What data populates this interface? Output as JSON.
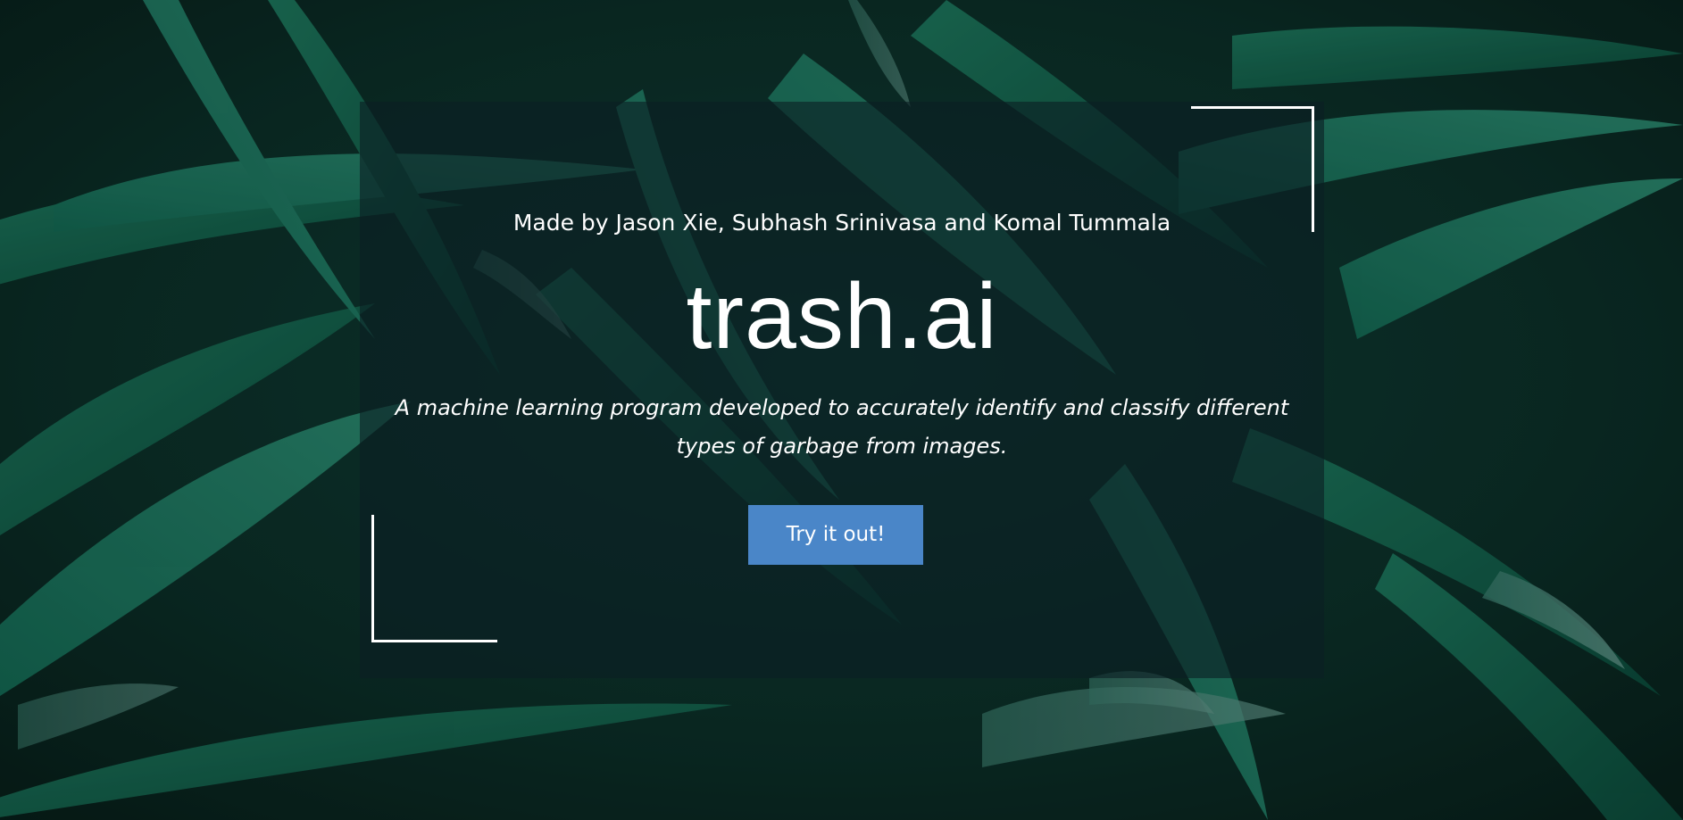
{
  "hero": {
    "background_image": "dark-green-leaves-photo",
    "credits": "Made by Jason Xie, Subhash Srinivasa and Komal Tummala",
    "title": "trash.ai",
    "tagline": "A machine learning program developed to accurately identify and classify different types of garbage from images.",
    "cta_label": "Try it out!"
  },
  "colors": {
    "accent": "#4a86c8",
    "text": "#ffffff",
    "leaves": "#0e5a45"
  }
}
